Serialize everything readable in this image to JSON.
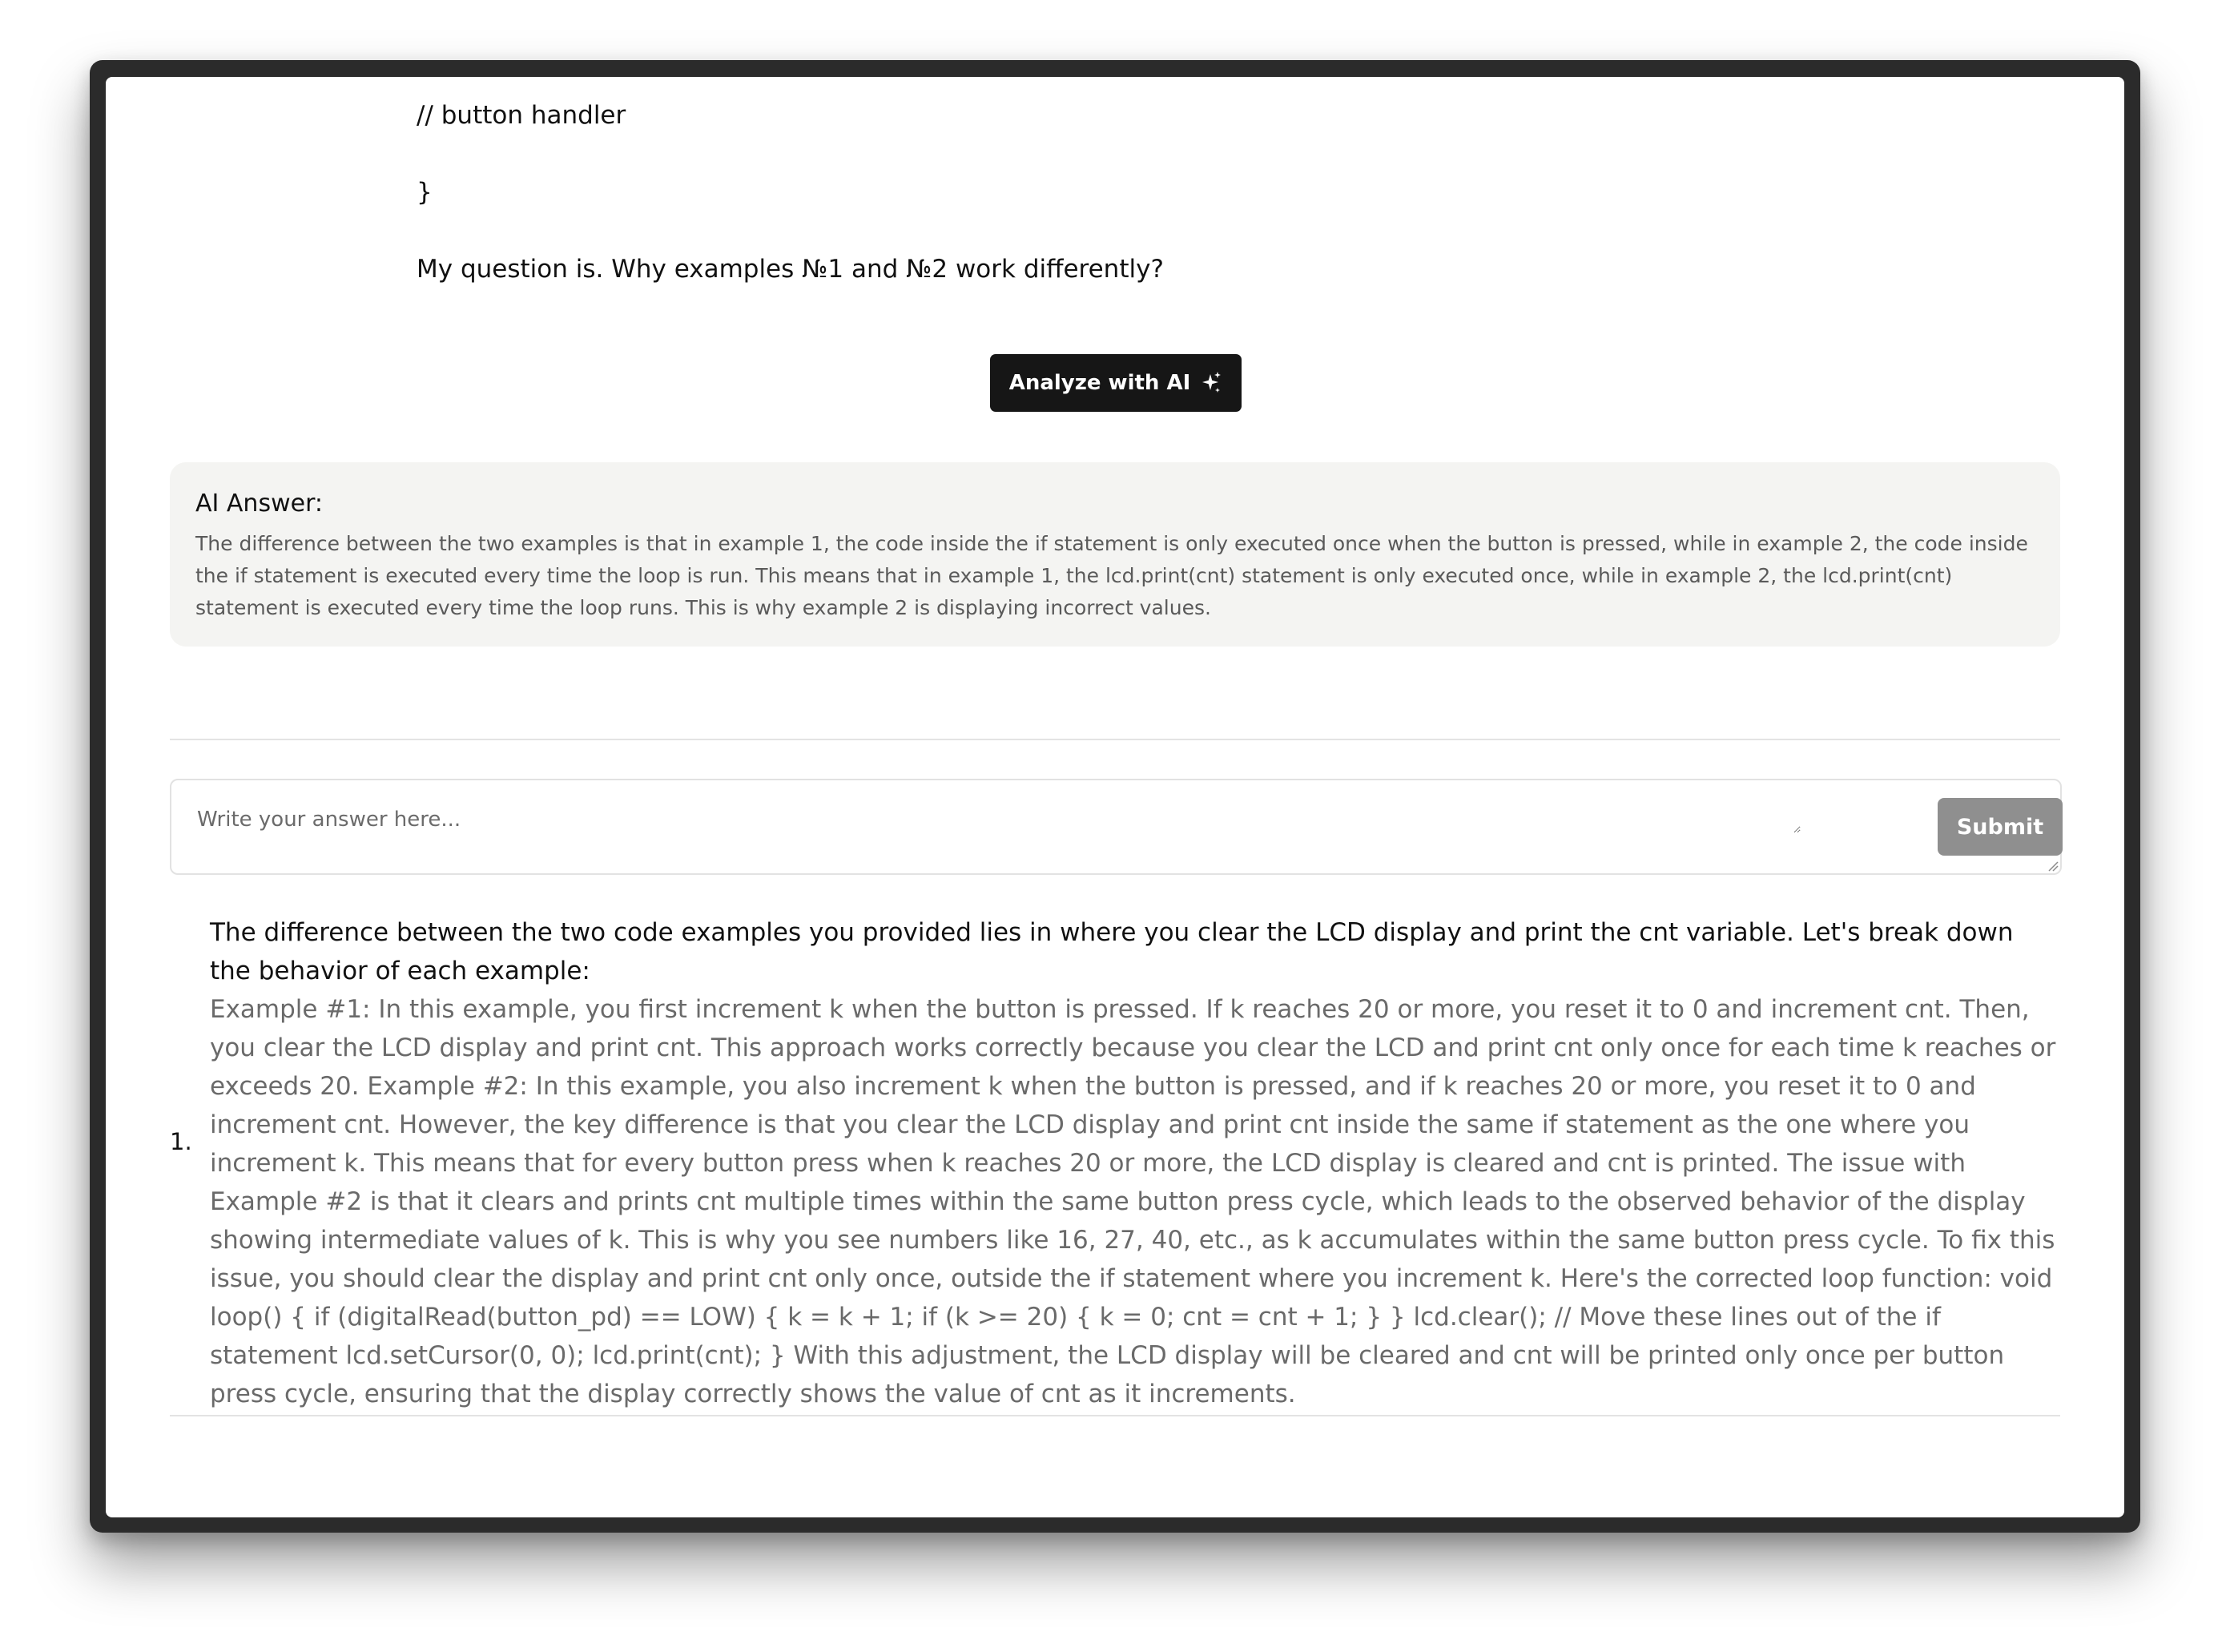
{
  "question": {
    "code_comment": "// button handler",
    "closing_brace": "}",
    "question_text": "My question is. Why examples №1 and №2 work differently?"
  },
  "analyze_button": {
    "label": "Analyze with AI",
    "icon": "sparkle-icon"
  },
  "ai_answer": {
    "title": "AI Answer:",
    "text": "The difference between the two examples is that in example 1, the code inside the if statement is only executed once when the button is pressed, while in example 2, the code inside the if statement is executed every time the loop is run. This means that in example 1, the lcd.print(cnt) statement is only executed once, while in example 2, the lcd.print(cnt) statement is executed every time the loop runs. This is why example 2 is displaying incorrect values."
  },
  "answer_form": {
    "placeholder": "Write your answer here...",
    "value": "",
    "submit_label": "Submit"
  },
  "responses": [
    {
      "number": "1.",
      "intro": "The difference between the two code examples you provided lies in where you clear the LCD display and print the cnt variable. Let's break down the behavior of each example:",
      "body": "Example #1: In this example, you first increment k when the button is pressed. If k reaches 20 or more, you reset it to 0 and increment cnt. Then, you clear the LCD display and print cnt. This approach works correctly because you clear the LCD and print cnt only once for each time k reaches or exceeds 20. Example #2: In this example, you also increment k when the button is pressed, and if k reaches 20 or more, you reset it to 0 and increment cnt. However, the key difference is that you clear the LCD display and print cnt inside the same if statement as the one where you increment k. This means that for every button press when k reaches 20 or more, the LCD display is cleared and cnt is printed. The issue with Example #2 is that it clears and prints cnt multiple times within the same button press cycle, which leads to the observed behavior of the display showing intermediate values of k. This is why you see numbers like 16, 27, 40, etc., as k accumulates within the same button press cycle. To fix this issue, you should clear the display and print cnt only once, outside the if statement where you increment k. Here's the corrected loop function: void loop() { if (digitalRead(button_pd) == LOW) { k = k + 1; if (k >= 20) { k = 0; cnt = cnt + 1; } } lcd.clear(); // Move these lines out of the if statement lcd.setCursor(0, 0); lcd.print(cnt); } With this adjustment, the LCD display will be cleared and cnt will be printed only once per button press cycle, ensuring that the display correctly shows the value of cnt as it increments."
    }
  ],
  "colors": {
    "button_dark": "#161616",
    "ai_box_bg": "#f4f4f2",
    "submit_bg": "#8f8f8f",
    "muted_text": "#6a6a6a"
  }
}
